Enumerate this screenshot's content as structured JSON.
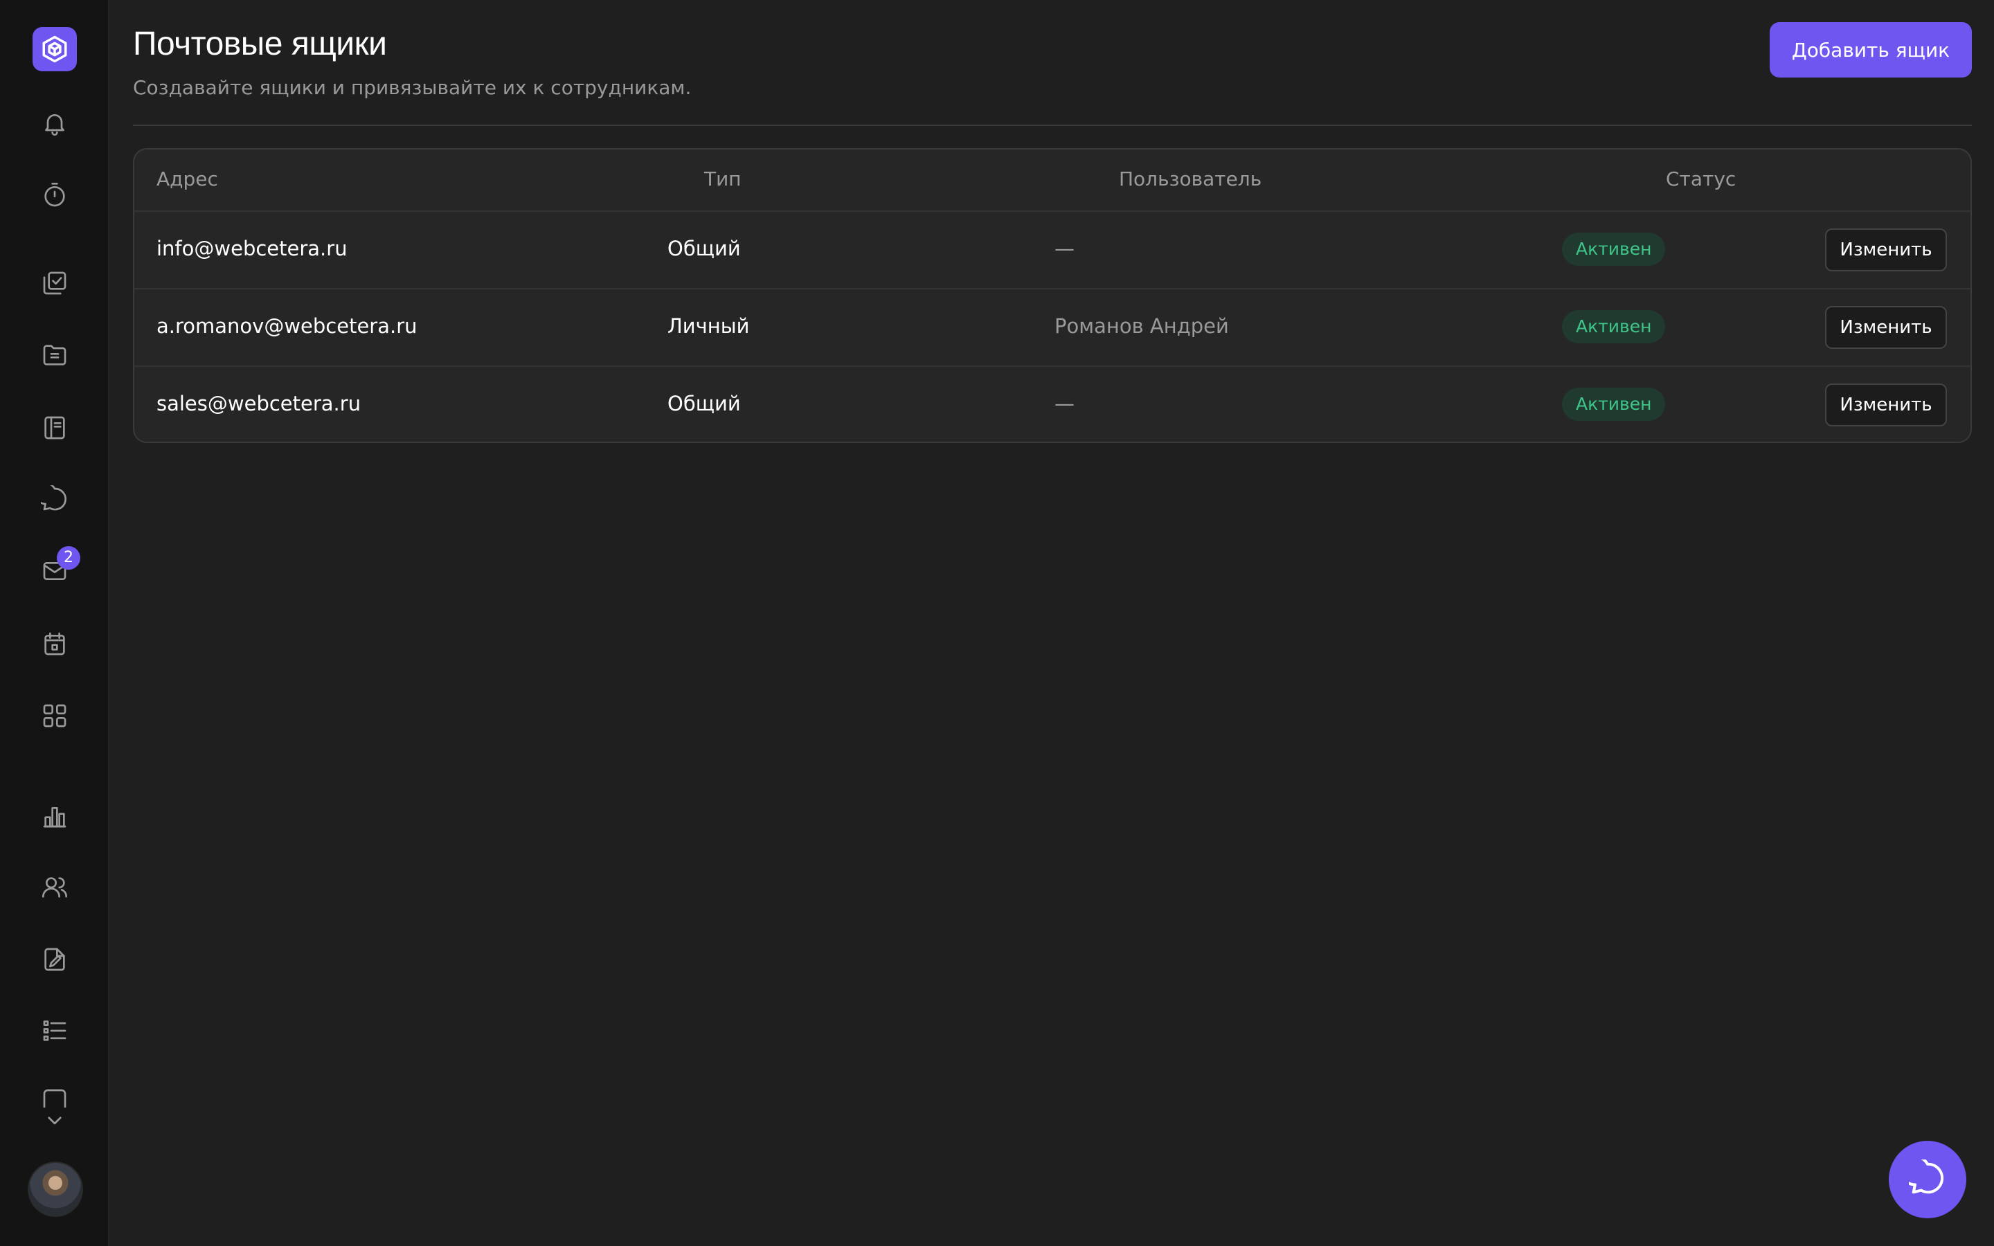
{
  "nav": {
    "logo_icon": "cube-logo-icon",
    "items": [
      {
        "icon": "bell-icon"
      },
      {
        "icon": "timer-icon"
      },
      {
        "icon": "tasks-icon"
      },
      {
        "icon": "folder-icon"
      },
      {
        "icon": "notebook-icon"
      },
      {
        "icon": "chat-icon"
      },
      {
        "icon": "mail-icon",
        "badge": "2"
      },
      {
        "icon": "calendar-icon"
      },
      {
        "icon": "apps-grid-icon"
      },
      {
        "icon": "bar-chart-icon"
      },
      {
        "icon": "users-icon"
      },
      {
        "icon": "document-edit-icon"
      },
      {
        "icon": "list-icon"
      },
      {
        "icon": "chevron-down-icon"
      }
    ]
  },
  "header": {
    "title": "Почтовые ящики",
    "subtitle": "Создавайте ящики и привязывайте их к сотрудникам.",
    "add_button_label": "Добавить ящик"
  },
  "table": {
    "columns": {
      "address": "Адрес",
      "type": "Тип",
      "user": "Пользователь",
      "status": "Статус"
    },
    "rows": [
      {
        "address": "info@webcetera.ru",
        "type": "Общий",
        "user": "—",
        "status": "Активен",
        "action": "Изменить"
      },
      {
        "address": "a.romanov@webcetera.ru",
        "type": "Личный",
        "user": "Романов Андрей",
        "status": "Активен",
        "action": "Изменить"
      },
      {
        "address": "sales@webcetera.ru",
        "type": "Общий",
        "user": "—",
        "status": "Активен",
        "action": "Изменить"
      }
    ]
  },
  "colors": {
    "accent": "#6f56f0",
    "background": "#1f1f1f",
    "sidebar": "#141414",
    "status_active_text": "#3fc58a",
    "status_active_bg": "#203a2f"
  },
  "fab": {
    "icon": "chat-bubble-icon"
  }
}
